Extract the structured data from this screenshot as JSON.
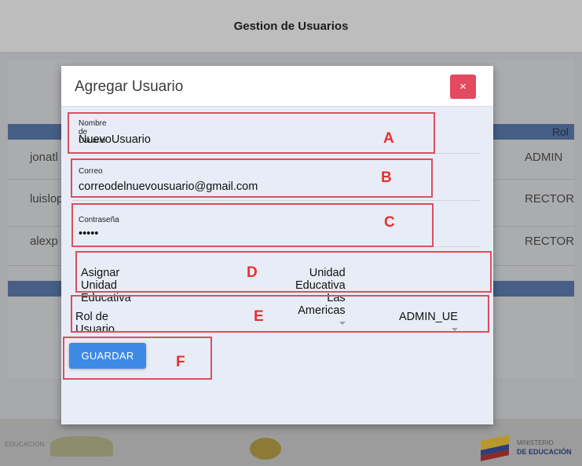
{
  "page": {
    "title": "Gestion de Usuarios"
  },
  "table": {
    "header_rol": "Rol",
    "rows": [
      {
        "user": "jonatl",
        "rol": "ADMIN"
      },
      {
        "user": "luislop",
        "rol": "RECTOR"
      },
      {
        "user": "alexp",
        "rol": "RECTOR"
      }
    ]
  },
  "modal": {
    "title": "Agregar Usuario",
    "close_label": "×",
    "username": {
      "label": "Nombre de Usuario",
      "value": "NuevoUsuario"
    },
    "email": {
      "label": "Correo",
      "value": "correodelnuevousuario@gmail.com"
    },
    "password": {
      "label": "Contraseña",
      "value": "•••••"
    },
    "unidad": {
      "label": "Asignar Unidad Educativa",
      "value": "Unidad Educativa Las Americas"
    },
    "rol": {
      "label": "Rol de Usuario",
      "value": "ADMIN_UE"
    },
    "save_label": "GUARDAR"
  },
  "annotations": [
    "A",
    "B",
    "C",
    "D",
    "E",
    "F"
  ],
  "footer": {
    "logo1_text": "EDUCACION",
    "logo3_line1": "MINISTERIO",
    "logo3_line2": "DE EDUCACIÓN"
  },
  "colors": {
    "accent": "#3d8ae4",
    "close": "#e34a5f",
    "annotation": "#d9505d",
    "table_header": "#475f86"
  }
}
